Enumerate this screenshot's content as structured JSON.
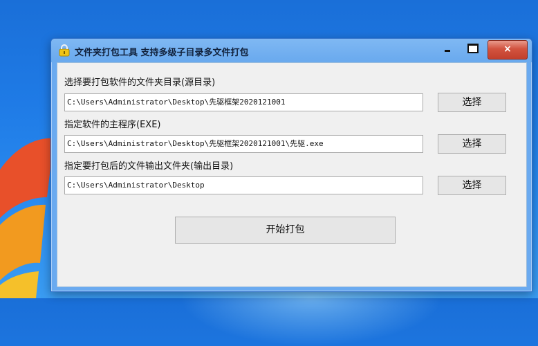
{
  "window": {
    "title": "文件夹打包工具  支持多级子目录多文件打包",
    "close_symbol": "×"
  },
  "form": {
    "source_label": "选择要打包软件的文件夹目录(源目录)",
    "source_value": "C:\\Users\\Administrator\\Desktop\\先驱框架2020121001",
    "main_label": "指定软件的主程序(EXE)",
    "main_value": "C:\\Users\\Administrator\\Desktop\\先驱框架2020121001\\先驱.exe",
    "output_label": "指定要打包后的文件输出文件夹(输出目录)",
    "output_value": "C:\\Users\\Administrator\\Desktop",
    "choose_label": "选择",
    "start_label": "开始打包"
  },
  "icons": {
    "title": "lock-icon",
    "minimize": "minimize-icon",
    "maximize": "maximize-icon",
    "close": "close-icon"
  },
  "colors": {
    "desktop": "#1f7be6",
    "titlebar": "#69a9ee",
    "close": "#c94a36"
  }
}
